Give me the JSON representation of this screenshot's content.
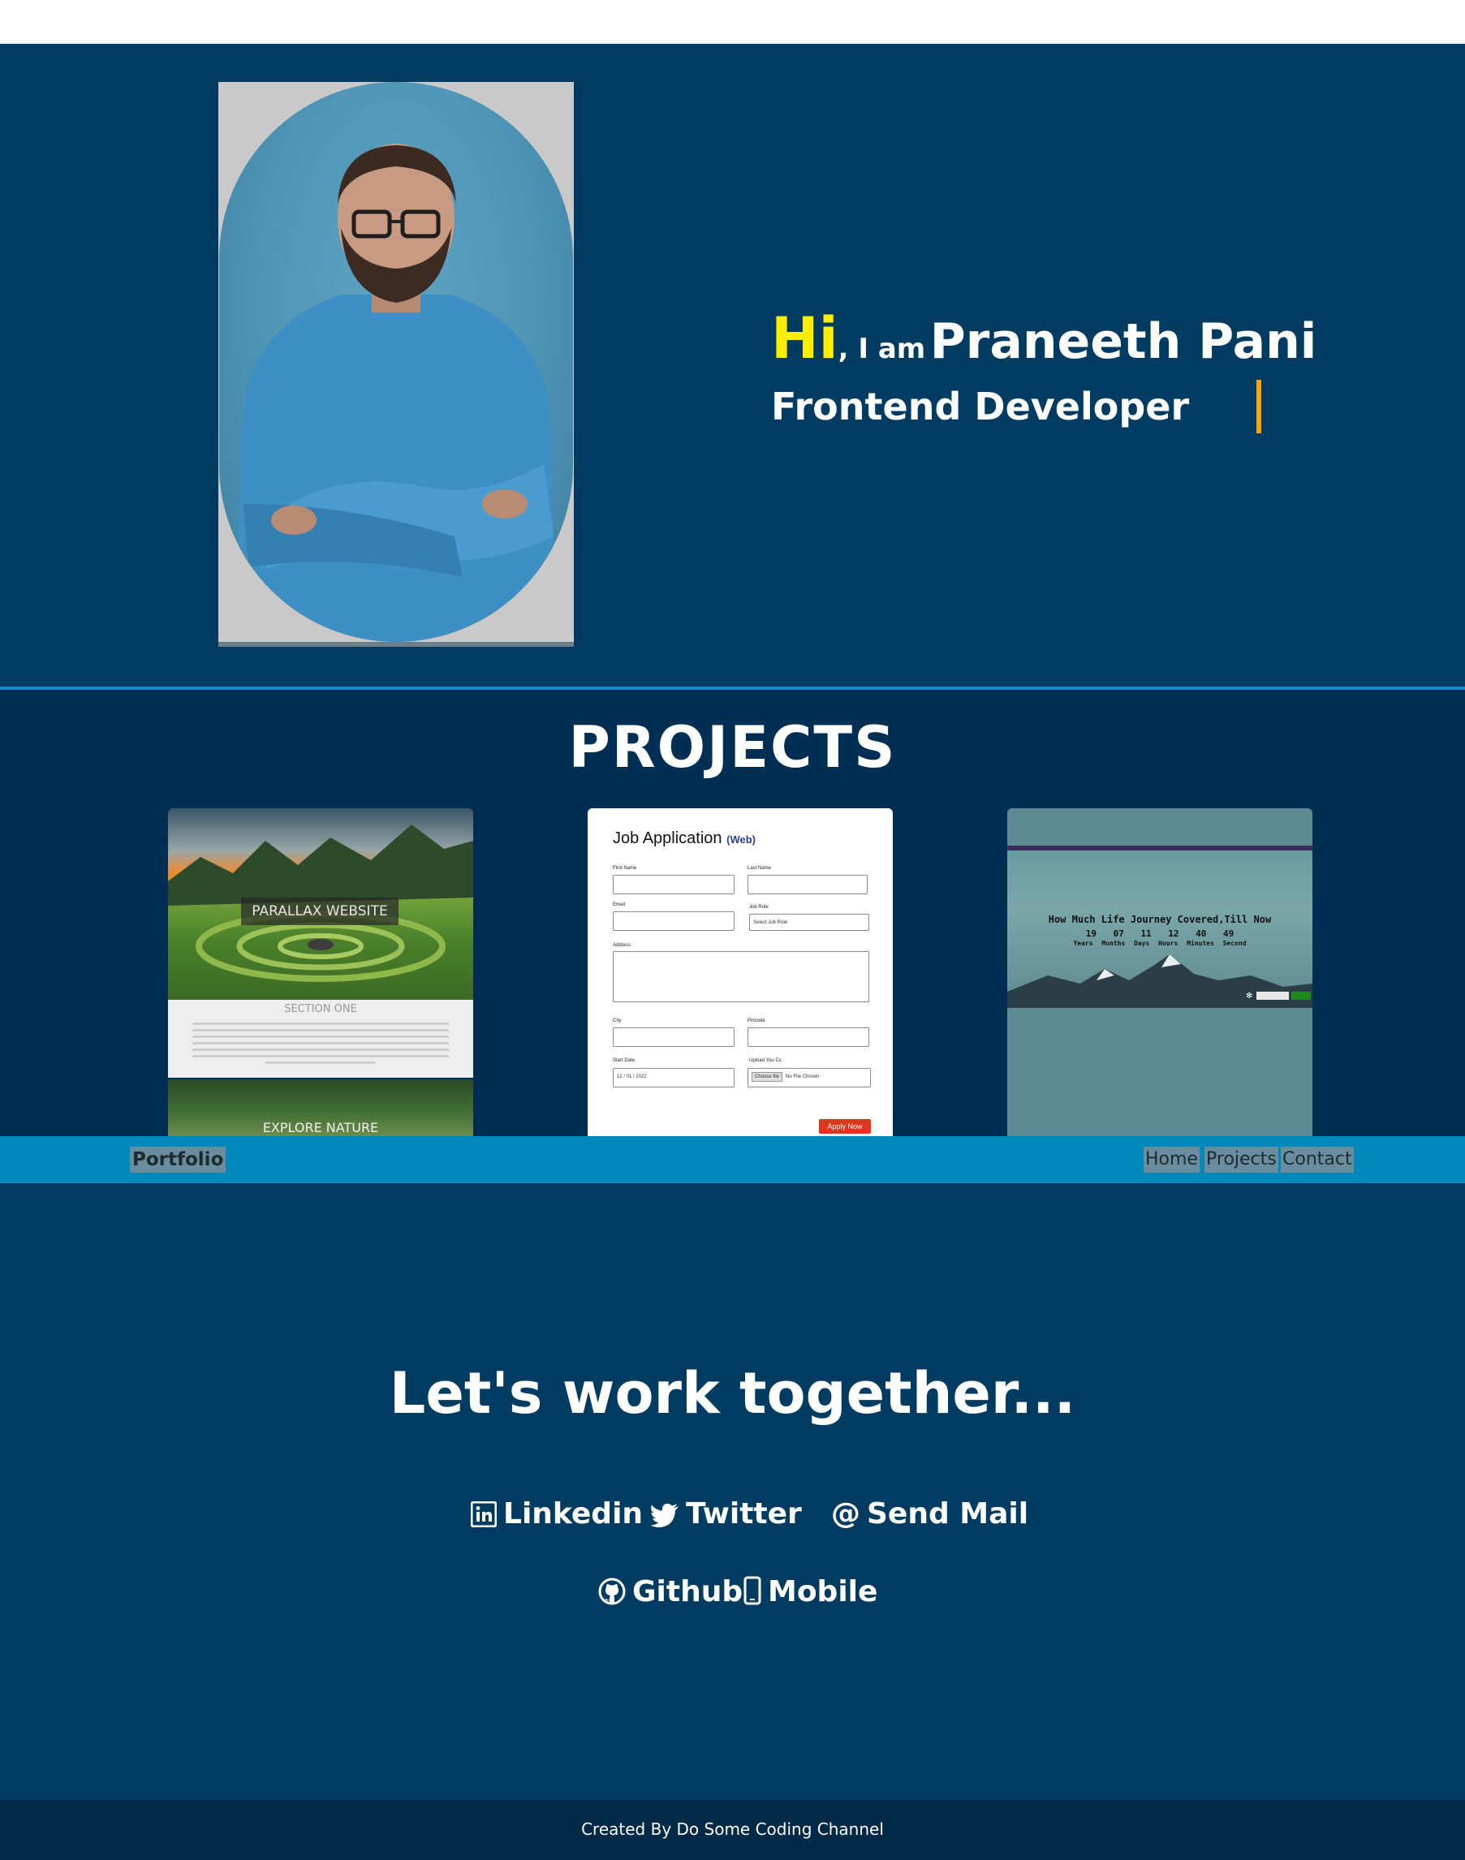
{
  "hero": {
    "greeting_hi": "Hi",
    "greeting_iam": ", I am",
    "name": "Praneeth Pani",
    "role": "Frontend Developer"
  },
  "projects": {
    "title": "PROJECTS",
    "cards": [
      {
        "hero_label": "PARALLAX WEBSITE",
        "section_title": "SECTION ONE",
        "bottom_label": "EXPLORE NATURE"
      },
      {
        "title": "Job Application",
        "subtitle": "(Web)",
        "labels": {
          "first_name": "First Name",
          "last_name": "Last Name",
          "email": "Email",
          "job_role": "Job Role",
          "address": "Address",
          "city": "City",
          "pincode": "Pincode",
          "start_date": "Start Date",
          "upload_cv": "Upload You Cv"
        },
        "job_role_value": "Select Job Role",
        "start_date_value": "12 / 01 / 2022",
        "choose_file": "Choose file",
        "no_file": "No File Chosen",
        "apply_button": "Apply Now"
      },
      {
        "title": "How Much Life Journey Covered,Till Now",
        "numbers": "19 07 11 12 40 49",
        "units": "Years Months Days Hours Minutes Second"
      }
    ]
  },
  "nav": {
    "brand": "Portfolio",
    "links": [
      "Home",
      "Projects",
      "Contact"
    ]
  },
  "contact": {
    "title": "Let's work together...",
    "linkedin": "Linkedin",
    "twitter": "Twitter",
    "mail_symbol": "@",
    "mail": "Send Mail",
    "github": "Github",
    "mobile": "Mobile"
  },
  "footer": {
    "text": "Created By Do Some Coding Channel"
  },
  "colors": {
    "page_bg": "#003c62",
    "projects_bg": "#002f53",
    "navbar_bg": "#0088ba",
    "footer_bg": "#002a47",
    "accent_yellow": "#ffee00",
    "cursor_orange": "#f3a712"
  },
  "icons": [
    "linkedin-icon",
    "twitter-icon",
    "github-icon",
    "mobile-icon"
  ]
}
